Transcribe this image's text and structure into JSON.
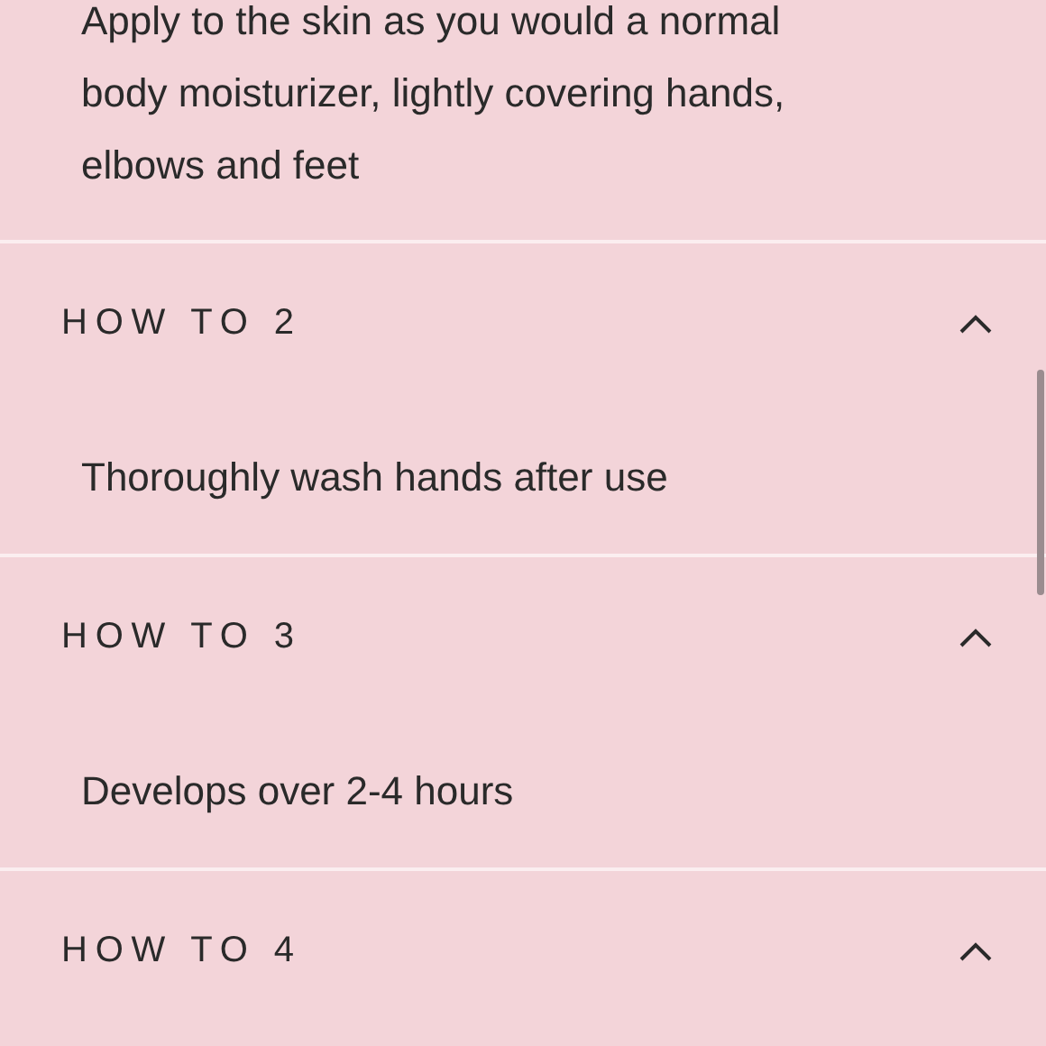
{
  "sections": [
    {
      "body": "Apply to the skin as you would a normal body moisturizer, lightly covering hands, elbows and feet"
    },
    {
      "title": "HOW TO 2",
      "expanded": true,
      "body": "Thoroughly wash hands after use"
    },
    {
      "title": "HOW TO 3",
      "expanded": true,
      "body": "Develops over 2-4 hours"
    },
    {
      "title": "HOW TO 4",
      "expanded": true
    }
  ]
}
